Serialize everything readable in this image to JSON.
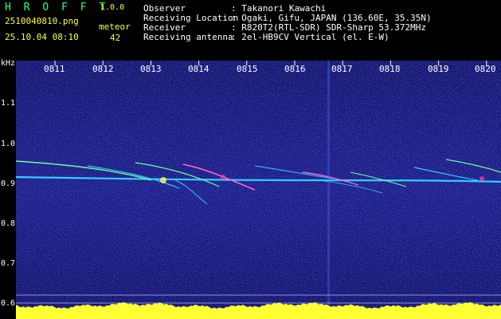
{
  "brand": "H R O F F T",
  "version": "1.0.0",
  "filename": "2510040810.png",
  "datetime": "25.10.04 08:10",
  "meteor_label": "meteor",
  "meteor_count": "42",
  "info": [
    {
      "label": "Observer",
      "value": ": Takanori Kawachi"
    },
    {
      "label": "Receiving Location",
      "value": ": Ogaki, Gifu, JAPAN (136.60E, 35.35N)"
    },
    {
      "label": "Receiver",
      "value": ": R820T2(RTL-SDR) SDR-Sharp 53.372MHz"
    },
    {
      "label": "Receiving antenna",
      "value": ": 2el-HB9CV Vertical (el. E-W)"
    }
  ],
  "axis": {
    "y_unit": "kHz",
    "y_ticks": [
      "1.1",
      "1.0",
      "0.9",
      "0.8",
      "0.7",
      "0.6"
    ],
    "x_ticks": [
      "0811",
      "0812",
      "0813",
      "0814",
      "0815",
      "0816",
      "0817",
      "0818",
      "0819",
      "0820"
    ]
  },
  "colors": {
    "background": "#1a1a80",
    "signal_main": "#33ccff",
    "signal_hot": "#ff3399",
    "signal_mid": "#33ff66",
    "noise_bar": "#ffff33",
    "label_green": "#33ff66",
    "label_yellow": "#ffff33"
  }
}
